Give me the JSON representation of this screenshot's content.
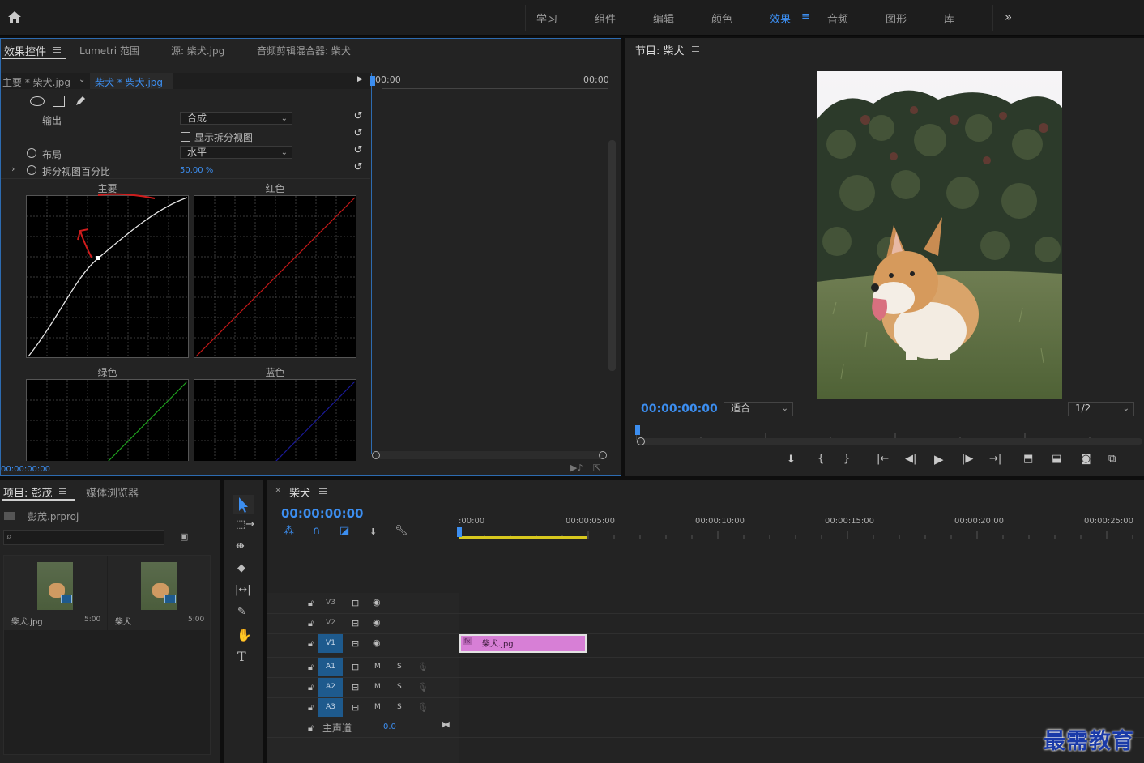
{
  "workspaces": [
    "学习",
    "组件",
    "编辑",
    "颜色",
    "效果",
    "音频",
    "图形",
    "库"
  ],
  "active_workspace": "效果",
  "effect_panel": {
    "tabs": [
      "效果控件",
      "Lumetri 范围",
      "源: 柴犬.jpg",
      "音频剪辑混合器: 柴犬"
    ],
    "master_clip": "主要 * 柴犬.jpg",
    "sequence_clip": "柴犬 * 柴犬.jpg",
    "output_label": "输出",
    "output_value": "合成",
    "show_split_label": "显示拆分视图",
    "layout_label": "布局",
    "layout_value": "水平",
    "split_percent_label": "拆分视图百分比",
    "split_percent_value": "50.00 %",
    "curve_labels": [
      "主要",
      "红色",
      "绿色",
      "蓝色"
    ],
    "timeline_start": "00:00",
    "timeline_end": "00:00",
    "footer_time": "00:00:00:00"
  },
  "program_monitor": {
    "title": "节目: 柴犬",
    "timecode": "00:00:00:00",
    "zoom": "适合",
    "resolution": "1/2"
  },
  "project_panel": {
    "tabs": [
      "项目: 彭茂",
      "媒体浏览器"
    ],
    "project_file": "彭茂.prproj",
    "search_placeholder": "",
    "items": [
      {
        "name": "柴犬.jpg",
        "duration": "5:00"
      },
      {
        "name": "柴犬",
        "duration": "5:00"
      }
    ]
  },
  "timeline": {
    "sequence_name": "柴犬",
    "timecode": "00:00:00:00",
    "ruler": [
      ":00:00",
      "00:00:05:00",
      "00:00:10:00",
      "00:00:15:00",
      "00:00:20:00",
      "00:00:25:00"
    ],
    "video_tracks": [
      "V3",
      "V2",
      "V1"
    ],
    "audio_tracks": [
      "A1",
      "A2",
      "A3"
    ],
    "mute": "M",
    "solo": "S",
    "master_track": "主声道",
    "master_value": "0.0",
    "clip_label": "柴犬.jpg",
    "fx_badge": "fx"
  },
  "watermark": "最需教育"
}
